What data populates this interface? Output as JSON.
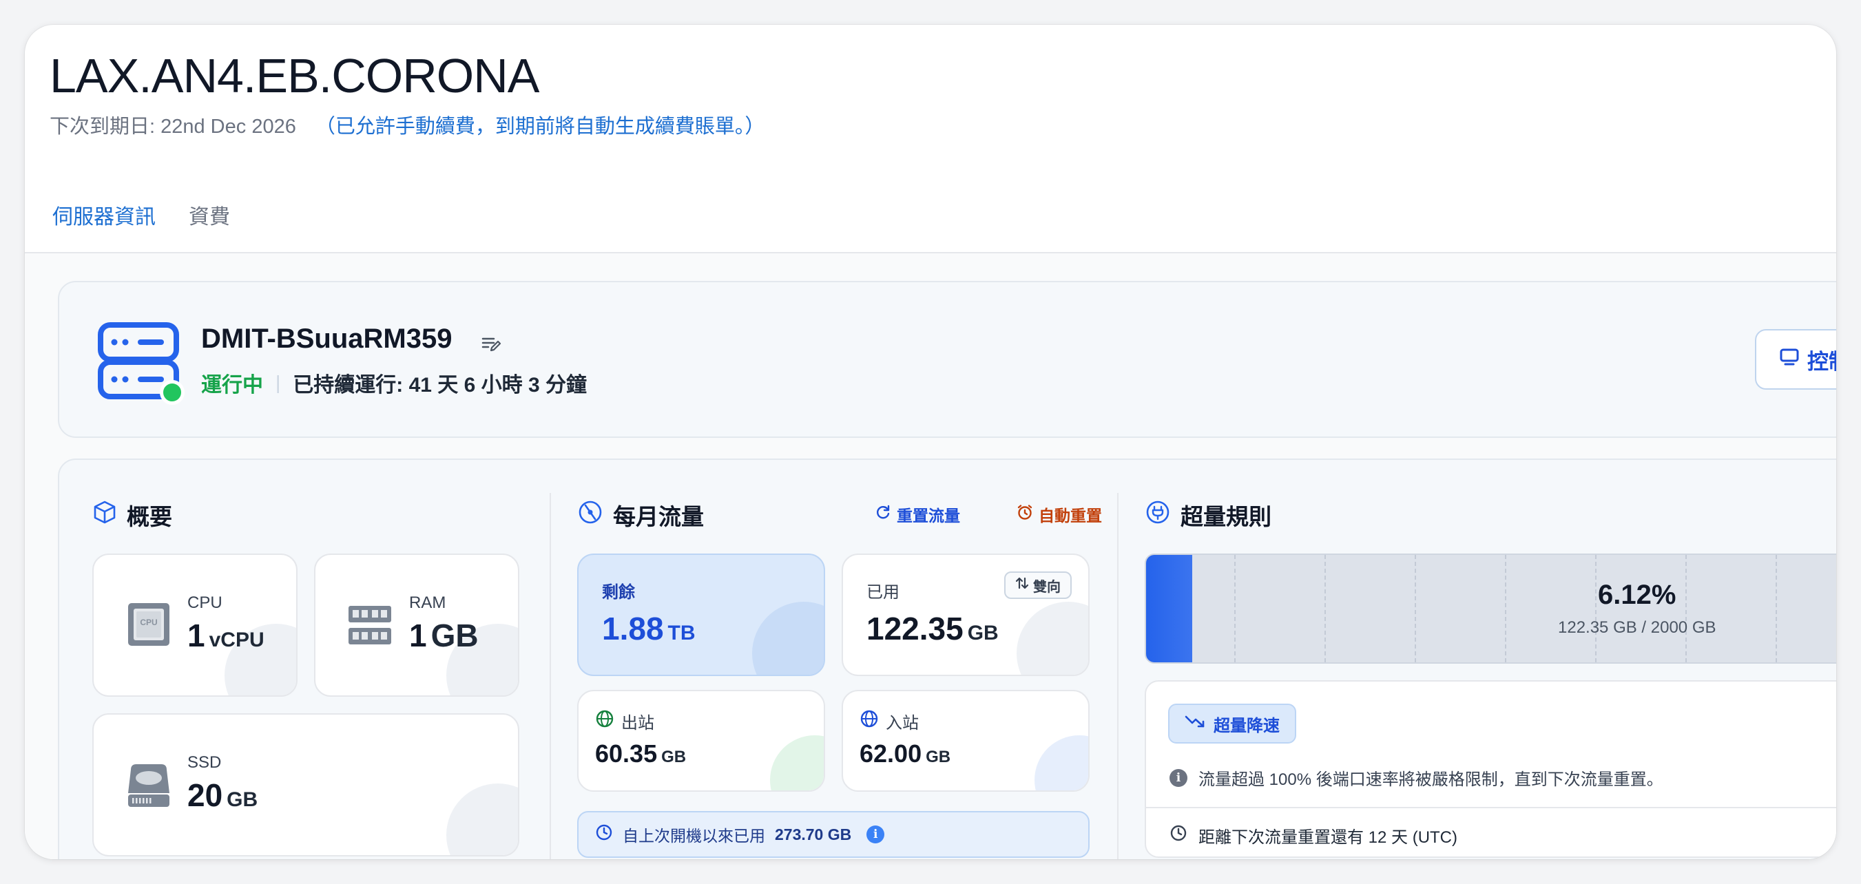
{
  "header": {
    "title": "LAX.AN4.EB.CORONA",
    "due_label": "下次到期日: 22nd Dec 2026",
    "renew_note": "（已允許手動續費，到期前將自動生成續費賬單。）"
  },
  "tabs": [
    {
      "label": "伺服器資訊",
      "active": true
    },
    {
      "label": "資費",
      "active": false
    }
  ],
  "server": {
    "name": "DMIT-BSuuaRM359",
    "status": "運行中",
    "separator": "|",
    "uptime": "已持續運行: 41 天 6 小時 3 分鐘",
    "control_label": "控制",
    "status_color": "#22c55e"
  },
  "overview": {
    "title": "概要",
    "cpu": {
      "label": "CPU",
      "value": "1",
      "unit": "vCPU",
      "chip_text": "CPU"
    },
    "ram": {
      "label": "RAM",
      "value": "1",
      "unit": "GB"
    },
    "ssd": {
      "label": "SSD",
      "value": "20",
      "unit": "GB"
    }
  },
  "traffic": {
    "title": "每月流量",
    "reset_label": "重置流量",
    "auto_reset_label": "自動重置",
    "remaining": {
      "label": "剩餘",
      "value": "1.88",
      "unit": "TB"
    },
    "used": {
      "label": "已用",
      "value": "122.35",
      "unit": "GB",
      "badge": "雙向"
    },
    "outbound": {
      "label": "出站",
      "value": "60.35",
      "unit": "GB"
    },
    "inbound": {
      "label": "入站",
      "value": "62.00",
      "unit": "GB"
    },
    "boot_note_prefix": "自上次開機以來已用",
    "boot_note_value": "273.70 GB"
  },
  "overage": {
    "title": "超量規則",
    "percent_label": "6.12%",
    "percent_value": 6.12,
    "detail": "122.35 GB / 2000 GB",
    "rule_badge": "超量降速",
    "rule_desc": "流量超過 100% 後端口速率將被嚴格限制，直到下次流量重置。",
    "reset_countdown": "距離下次流量重置還有 12 天 (UTC)"
  },
  "colors": {
    "accent": "#1d6fd1",
    "running": "#16a34a",
    "auto_reset": "#c2410c",
    "usage_fill": "#2563eb"
  }
}
